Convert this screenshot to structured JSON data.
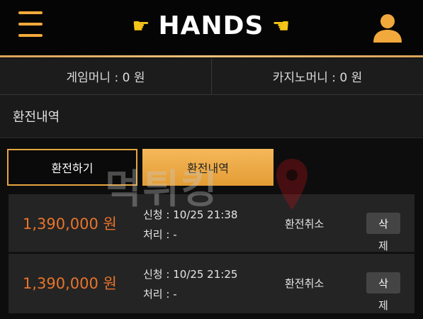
{
  "header": {
    "brand": "HANDS",
    "menu_icon": "hamburger-menu-icon",
    "user_icon": "user-icon",
    "accent_color": "#f2a93b"
  },
  "balances": {
    "game_money": "게임머니 : 0 원",
    "casino_money": "카지노머니 : 0 원"
  },
  "page_title": "환전내역",
  "tabs": [
    {
      "label": "환전하기",
      "active": false
    },
    {
      "label": "환전내역",
      "active": true
    }
  ],
  "rows": [
    {
      "amount": "1,390,000 원",
      "request": "신청 : 10/25 21:38",
      "processed": "처리 : -",
      "status": "환전취소",
      "delete_label_top": "삭",
      "delete_label_bottom": "제"
    },
    {
      "amount": "1,390,000 원",
      "request": "신청 : 10/25 21:25",
      "processed": "처리 : -",
      "status": "환전취소",
      "delete_label_top": "삭",
      "delete_label_bottom": "제"
    }
  ],
  "watermark": {
    "text": "먹튀킹",
    "icon": "location-pin-icon"
  }
}
